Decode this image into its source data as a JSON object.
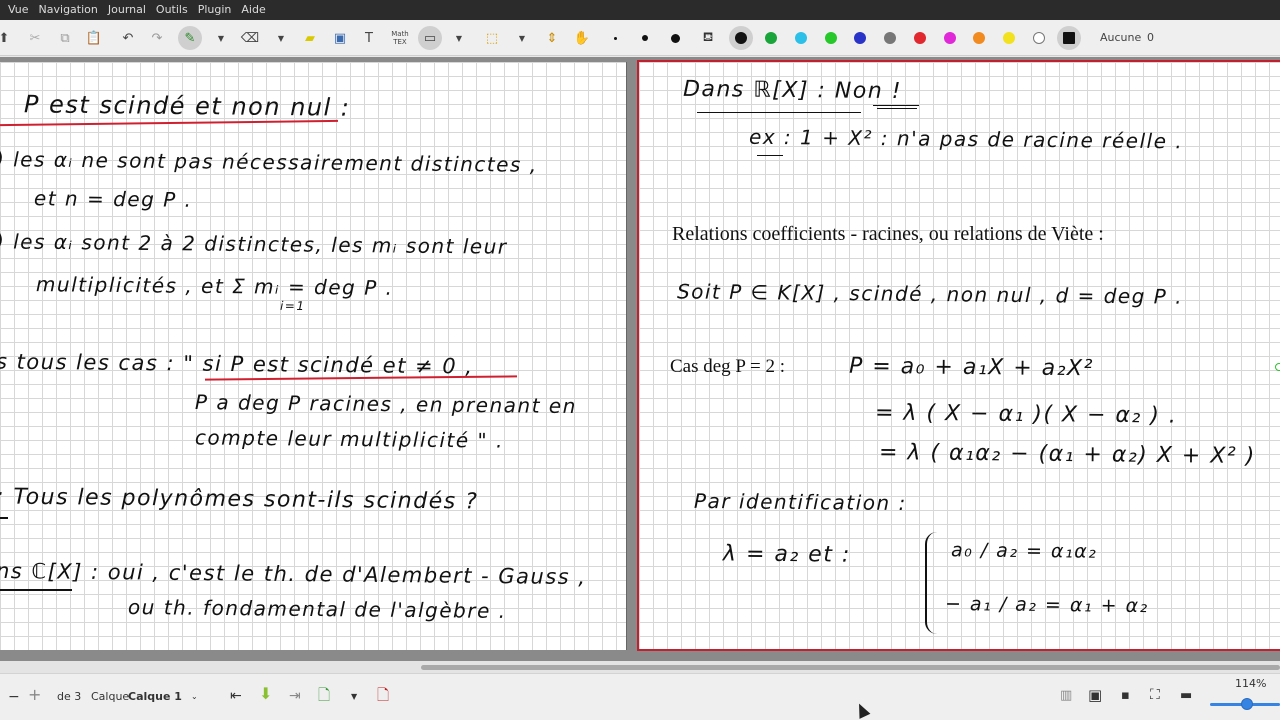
{
  "menu": [
    "Vue",
    "Navigation",
    "Journal",
    "Outils",
    "Plugin",
    "Aide"
  ],
  "toolbar": {
    "math_label": "Math\nTEX",
    "aucune_label": "Aucune",
    "count_label": "0",
    "colors": [
      "#111111",
      "#1aa53a",
      "#2cc0e9",
      "#27c82a",
      "#2a33c8",
      "#777777",
      "#e0282e",
      "#e028d8",
      "#f18b1f",
      "#f1e11f",
      "#ffffff",
      "#111111"
    ]
  },
  "left_page": {
    "lines": [
      "P est scindé et non nul :",
      ") les αᵢ ne sont pas nécessairement distinctes ,",
      "et   n = deg P .",
      ") les αᵢ sont 2 à 2 distinctes, les mᵢ sont leur",
      "multiplicités , et   Σ mᵢ  = deg P .",
      "i=1",
      "s tous les cas : \"  si P est scindé et ≠ 0 ,",
      "P a deg P racines , en prenant en",
      "compte leur multiplicité \" .",
      ":   Tous les polynômes sont-ils scindés ?",
      "ns ℂ[X] :  oui , c'est le th. de d'Alembert - Gauss ,",
      "ou th. fondamental de l'algèbre ."
    ]
  },
  "right_page": {
    "header": "Dans ℝ[X] :  Non  !",
    "example": "ex :    1 + X²   :   n'a pas de racine réelle .",
    "relations_title": "Relations coefficients - racines, ou relations de Viète :",
    "soit_line": "Soit  P ∈ K[X] , scindé , non nul ,   d = deg P .",
    "cas_label": "Cas deg P = 2 :",
    "eq1": "P =   a₀ + a₁X + a₂X²",
    "eq2": "=  λ  ( X − α₁ )( X − α₂ ) .",
    "eq3": "=  λ  ( α₁α₂  − (α₁ + α₂) X  +  X² )",
    "ident": "Par identification :",
    "lambda_eq": "λ = a₂      et :",
    "sys1": "a₀ / a₂  =  α₁α₂",
    "sys2": "− a₁ / a₂  =  α₁ + α₂"
  },
  "statusbar": {
    "page_of": "de 3",
    "calque_label": "Calque",
    "calque_value": "Calque 1",
    "zoom": "114%"
  }
}
